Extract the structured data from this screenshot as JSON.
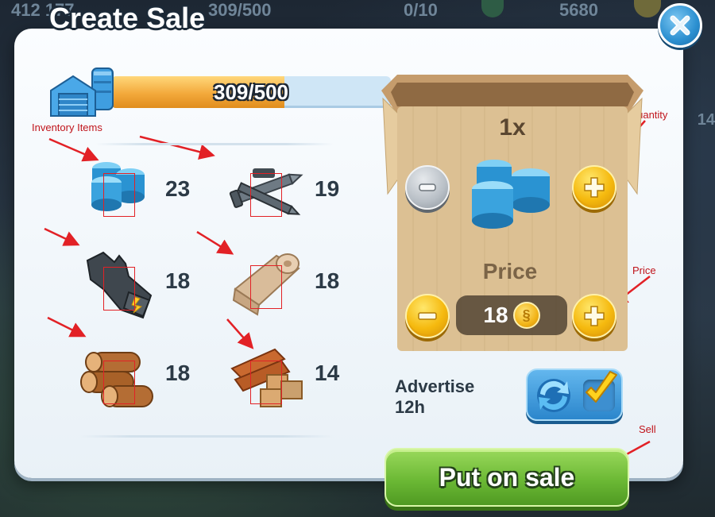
{
  "hud": {
    "population": "412 177",
    "storage": "309/500",
    "workers": "0/10",
    "simoleons": "5680",
    "side_value": "14"
  },
  "dialog": {
    "title": "Create Sale"
  },
  "storage": {
    "current": 309,
    "capacity": 500,
    "label": "309/500"
  },
  "annotations": {
    "inventory": "Inventory Items",
    "quantity": "Quantity",
    "price": "Price",
    "sell": "Sell"
  },
  "inventory": [
    {
      "name": "plastic",
      "icon": "plastic-icon",
      "count": "23"
    },
    {
      "name": "nails",
      "icon": "nails-icon",
      "count": "19"
    },
    {
      "name": "gloves",
      "icon": "gloves-icon",
      "count": "18"
    },
    {
      "name": "textiles",
      "icon": "textiles-icon",
      "count": "18"
    },
    {
      "name": "wood",
      "icon": "wood-icon",
      "count": "18"
    },
    {
      "name": "planks",
      "icon": "planks-icon",
      "count": "14"
    }
  ],
  "sale": {
    "quantity_label": "1x",
    "price_label": "Price",
    "price_value": "18",
    "coin_glyph": "§",
    "advertise_line1": "Advertise",
    "advertise_line2": "12h",
    "advertise_checked": true,
    "sell_label": "Put on sale"
  },
  "colors": {
    "accent_gold": "#f5b90e",
    "sell_green": "#6cb935",
    "dialog_bg": "#fbfdff",
    "annotation_red": "#e22126"
  }
}
